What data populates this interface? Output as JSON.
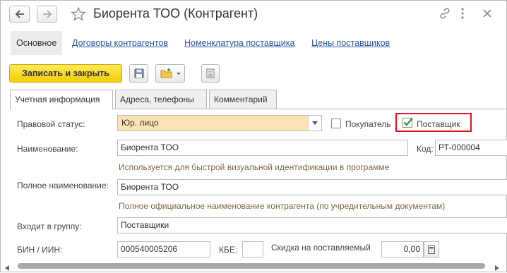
{
  "window": {
    "title": "Биорента ТОО (Контрагент)"
  },
  "nav_tabs": [
    {
      "label": "Основное"
    },
    {
      "label": "Договоры контрагентов"
    },
    {
      "label": "Номенклатура поставщика"
    },
    {
      "label": "Цены поставщиков"
    }
  ],
  "toolbar": {
    "save_close_label": "Записать и закрыть"
  },
  "form_tabs": [
    {
      "label": "Учетная информация"
    },
    {
      "label": "Адреса, телефоны"
    },
    {
      "label": "Комментарий"
    }
  ],
  "form": {
    "legal_status_label": "Правовой статус:",
    "legal_status_value": "Юр. лицо",
    "buyer_label": "Покупатель",
    "buyer_checked": false,
    "supplier_label": "Поставщик",
    "supplier_checked": true,
    "name_label": "Наименование:",
    "name_value": "Биорента ТОО",
    "code_label": "Код:",
    "code_value": "РТ-000004",
    "name_hint": "Используется для быстрой визуальной идентификации в программе",
    "full_name_label": "Полное наименование:",
    "full_name_value": "Биорента ТОО",
    "full_name_hint": "Полное официальное наименование контрагента (по учредительным документам)",
    "group_label": "Входит в группу:",
    "group_value": "Поставщики",
    "bin_label": "БИН / ИИН:",
    "bin_value": "000540005206",
    "kbe_label": "КБЕ:",
    "kbe_value": "",
    "discount_label": "Скидка на поставляемый",
    "discount_value": "0,00"
  },
  "colors": {
    "accent_button": "#f5d200",
    "highlight_box": "#e0141e",
    "link": "#2b58a3",
    "hint_text": "#7a6a44",
    "selected_field": "#fde3b4"
  }
}
